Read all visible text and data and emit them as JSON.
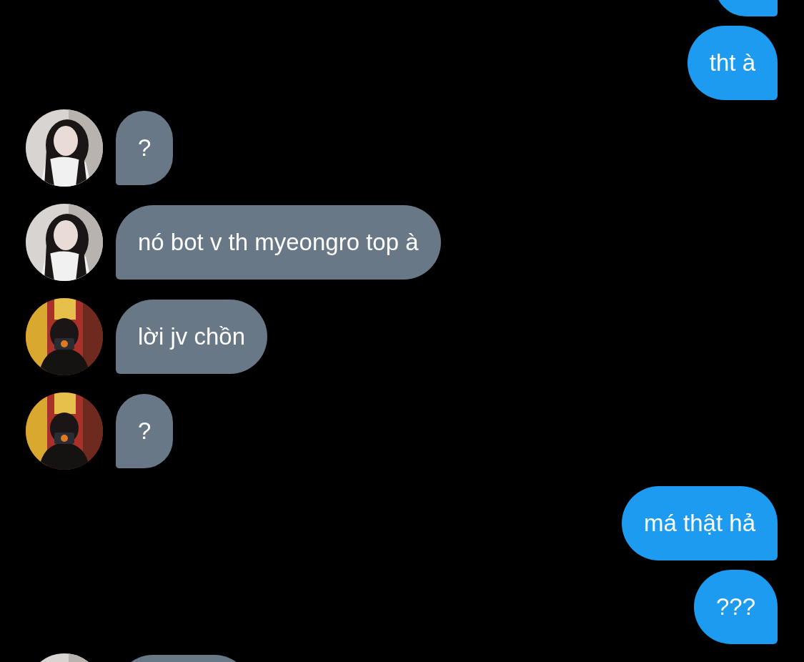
{
  "messages": [
    {
      "kind": "sent"
    },
    {
      "kind": "sent",
      "text": "tht à"
    },
    {
      "kind": "received",
      "text": "?"
    },
    {
      "kind": "received",
      "text": "nó bot v th myeongro top à"
    },
    {
      "kind": "received",
      "text": "lời jv chồn"
    },
    {
      "kind": "received",
      "text": "?"
    },
    {
      "kind": "sent",
      "text": "má thật hả"
    },
    {
      "kind": "sent",
      "text": "???"
    },
    {
      "kind": "received"
    }
  ]
}
